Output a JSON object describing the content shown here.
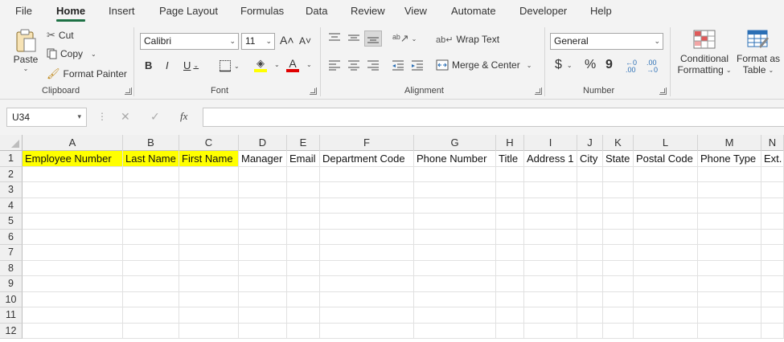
{
  "tabs": [
    "File",
    "Home",
    "Insert",
    "Page Layout",
    "Formulas",
    "Data",
    "Review",
    "View",
    "Automate",
    "Developer",
    "Help"
  ],
  "active_tab": "Home",
  "clipboard": {
    "paste": "Paste",
    "cut": "Cut",
    "copy": "Copy",
    "format_painter": "Format Painter",
    "label": "Clipboard"
  },
  "font": {
    "name": "Calibri",
    "size": "11",
    "bold": "B",
    "italic": "I",
    "underline": "U",
    "label": "Font"
  },
  "alignment": {
    "wrap_text": "Wrap Text",
    "merge_center": "Merge & Center",
    "label": "Alignment"
  },
  "number": {
    "format": "General",
    "currency": "$",
    "percent": "%",
    "comma": "9",
    "label": "Number"
  },
  "styles": {
    "conditional_1": "Conditional",
    "conditional_2": "Formatting",
    "format_as_1": "Format as",
    "format_as_2": "Table"
  },
  "formula_bar": {
    "name_box": "U34",
    "fx": "fx"
  },
  "columns": [
    "A",
    "B",
    "C",
    "D",
    "E",
    "F",
    "G",
    "H",
    "I",
    "J",
    "K",
    "L",
    "M",
    "N"
  ],
  "rows": [
    "1",
    "2",
    "3",
    "4",
    "5",
    "6",
    "7",
    "8",
    "9",
    "10",
    "11",
    "12"
  ],
  "header_row": [
    "Employee Number",
    "Last Name",
    "First Name",
    "Manager",
    "Email",
    "Department Code",
    "Phone Number",
    "Title",
    "Address 1",
    "City",
    "State",
    "Postal Code",
    "Phone Type",
    "Ext."
  ],
  "colors": {
    "accent": "#1e7145",
    "highlight": "#ffff00",
    "font_color": "#e00000"
  }
}
